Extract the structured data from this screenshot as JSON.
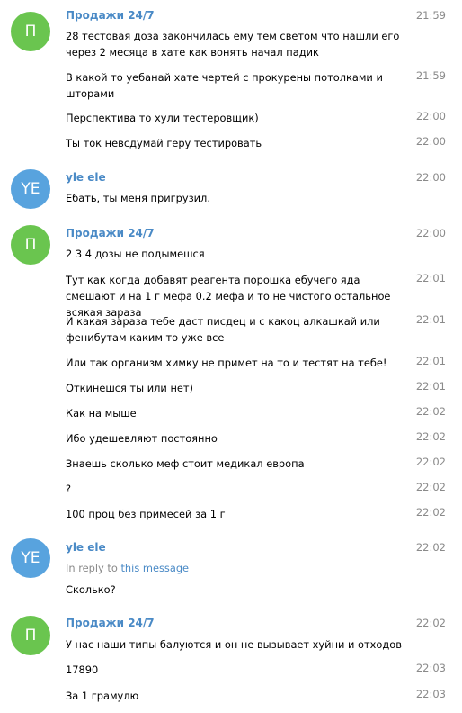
{
  "groups": [
    {
      "sender": "Продажи 24/7",
      "initial": "П",
      "messages": [
        {
          "text": "28 тестовая доза закончилась ему тем светом что нашли его через 2 месяца в хате как вонять начал падик",
          "time": "21:59"
        },
        {
          "text": "В какой то уебанай хате чертей с прокурены потолками и шторами",
          "time": "21:59"
        },
        {
          "text": "Перспектива то хули тестеровщик)",
          "time": "22:00"
        },
        {
          "text": "Ты ток невсдумай геру тестировать",
          "time": "22:00"
        }
      ]
    },
    {
      "sender": "yle ele",
      "initial": "YE",
      "messages": [
        {
          "text": "Ебать, ты меня пригрузил.",
          "time": "22:00"
        }
      ]
    },
    {
      "sender": "Продажи 24/7",
      "initial": "П",
      "messages": [
        {
          "text": "2 3 4 дозы не подымешся",
          "time": "22:00"
        },
        {
          "text": "Тут как когда добавят реагента порошка ебучего яда смешают и на 1 г мефа 0.2 мефа и то не чистого остальное всякая зараза",
          "time": "22:01"
        },
        {
          "text": "И какая зараза тебе даст писдец и с какоц алкашкай или фенибутам каким то уже все",
          "time": "22:01"
        },
        {
          "text": "Или так организм химку не примет на то и тестят на тебе!",
          "time": "22:01"
        },
        {
          "text": "Откинешся ты или нет)",
          "time": "22:01"
        },
        {
          "text": "Как на мыше",
          "time": "22:02"
        },
        {
          "text": "Ибо удешевляют постоянно",
          "time": "22:02"
        },
        {
          "text": "Знаешь сколько меф стоит медикал европа",
          "time": "22:02"
        },
        {
          "text": "?",
          "time": "22:02"
        },
        {
          "text": "100 проц без примесей за 1 г",
          "time": "22:02"
        }
      ]
    },
    {
      "sender": "yle ele",
      "initial": "YE",
      "reply_prefix": "In reply to",
      "reply_link": "this message",
      "messages": [
        {
          "text": "Сколько?",
          "time": "22:02"
        }
      ]
    },
    {
      "sender": "Продажи 24/7",
      "initial": "П",
      "messages": [
        {
          "text": "У нас наши типы балуются и он не вызывает хуйни и отходов",
          "time": "22:02"
        },
        {
          "text": "17890",
          "time": "22:03"
        },
        {
          "text": "За 1 грамулю",
          "time": "22:03"
        }
      ]
    }
  ],
  "colors": {
    "sender_name": "#4a8ac6",
    "avatar_prodazhi": "#6ac54f",
    "avatar_yle": "#58a3de",
    "time": "#8a8a8a"
  }
}
